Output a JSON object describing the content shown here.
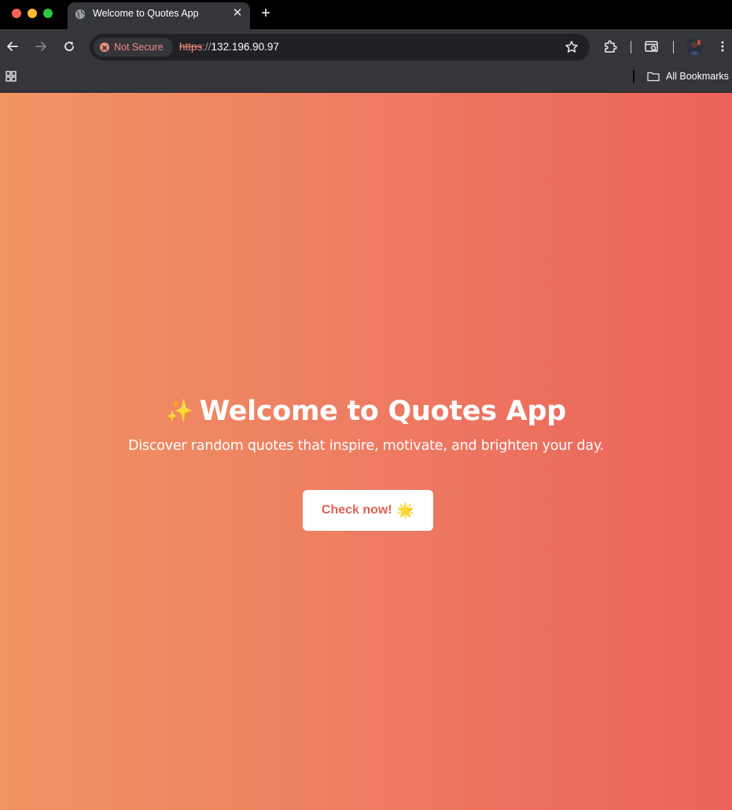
{
  "browser": {
    "tab": {
      "title": "Welcome to Quotes App",
      "icon": "globe-icon",
      "close_glyph": "✕"
    },
    "new_tab_glyph": "+",
    "address_bar": {
      "security_label": "Not Secure",
      "url_scheme": "https",
      "url_separator": "://",
      "url_host": "132.196.90.97"
    },
    "bookmarks_bar": {
      "all_bookmarks_label": "All Bookmarks"
    },
    "colors": {
      "frame": "#000000",
      "toolbar": "#35363a",
      "omnibox": "#202124",
      "insecure": "#f28b82"
    }
  },
  "page": {
    "title_icon": "✨",
    "title": "Welcome to Quotes App",
    "subtitle": "Discover random quotes that inspire, motivate, and brighten your day.",
    "cta_label": "Check now!",
    "cta_icon": "🌟",
    "colors": {
      "gradient_start": "#f09463",
      "gradient_end": "#eb625a",
      "cta_text": "#e0604f",
      "cta_background": "#ffffff"
    }
  }
}
